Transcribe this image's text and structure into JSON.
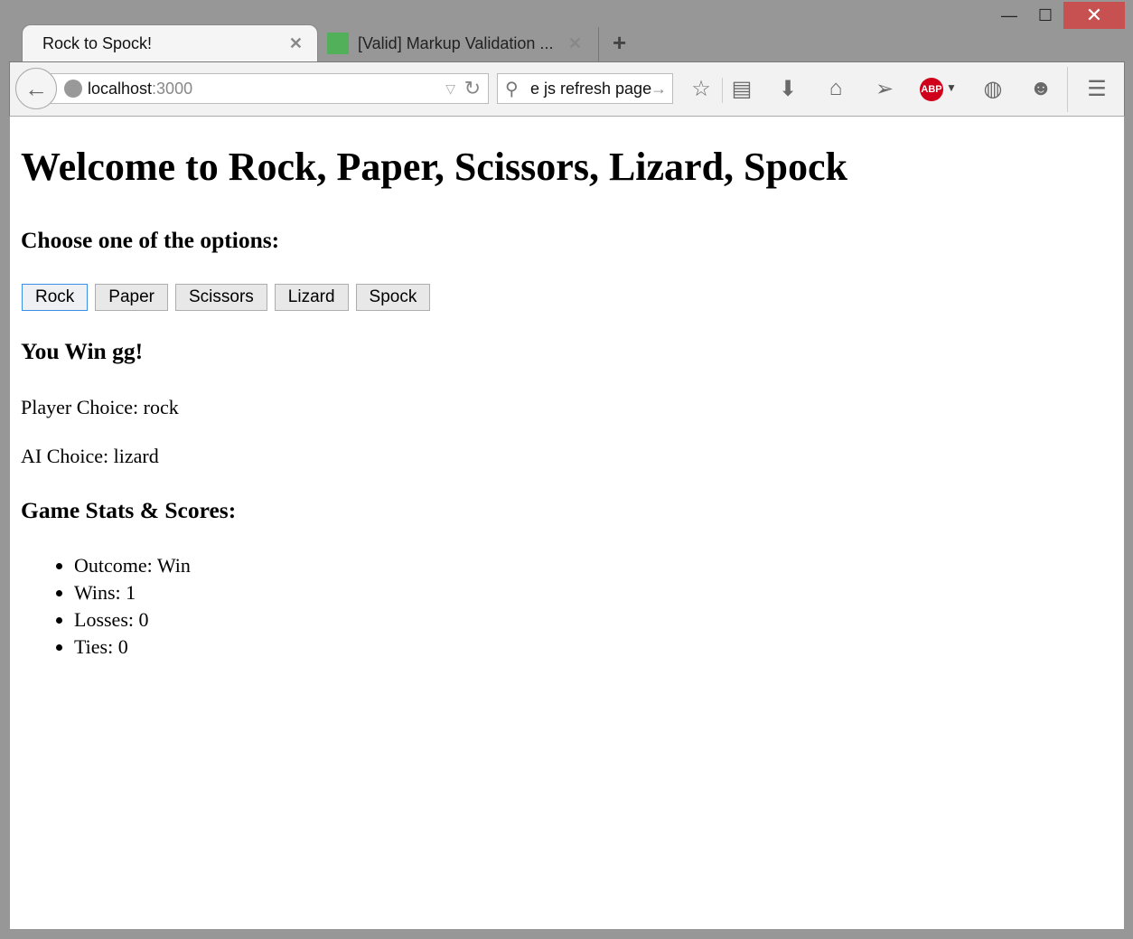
{
  "window": {
    "minimize": "—",
    "maximize": "☐",
    "close": "✕"
  },
  "tabs": [
    {
      "title": "Rock to Spock!"
    },
    {
      "title": "[Valid] Markup Validation ...",
      "favicon_color": "#53b05a"
    }
  ],
  "new_tab": "+",
  "url": {
    "host": "localhost",
    "port": ":3000"
  },
  "search": {
    "value": "e js refresh page"
  },
  "toolbar_icons": [
    "star-icon",
    "reading-list-icon",
    "download-icon",
    "home-icon",
    "send-icon",
    "adblock-plus-icon",
    "globe-edit-icon",
    "chat-icon",
    "menu-icon"
  ],
  "page": {
    "title": "Welcome to Rock, Paper, Scissors, Lizard, Spock",
    "choose": "Choose one of the options:",
    "buttons": [
      "Rock",
      "Paper",
      "Scissors",
      "Lizard",
      "Spock"
    ],
    "result": "You Win gg!",
    "player_choice": "Player Choice: rock",
    "ai_choice": "AI Choice: lizard",
    "stats_title": "Game Stats & Scores:",
    "stats": [
      "Outcome: Win",
      "Wins: 1",
      "Losses: 0",
      "Ties: 0"
    ]
  }
}
